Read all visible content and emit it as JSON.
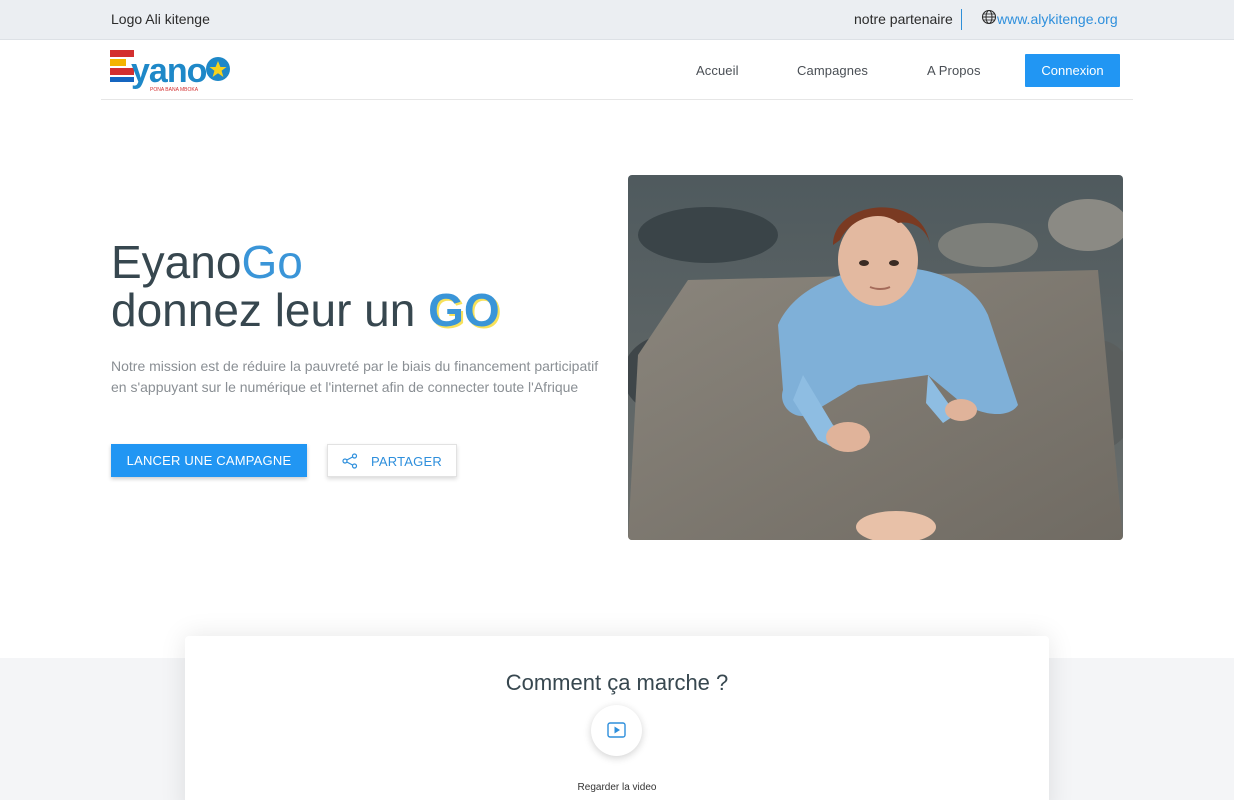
{
  "topbar": {
    "logo_text": "Logo Ali kitenge",
    "partner_text": "notre partenaire",
    "site_link": "www.alykitenge.org"
  },
  "navbar": {
    "brand_name": "Eyano",
    "brand_tagline": "PONA BANA MBOKA",
    "items": [
      {
        "label": "Accueil"
      },
      {
        "label": "Campagnes"
      },
      {
        "label": "A Propos"
      }
    ],
    "login_label": "Connexion"
  },
  "hero": {
    "title_part1": "Eyano",
    "title_part2": "Go",
    "title_line2": "donnez leur un ",
    "title_go": "GO",
    "description": "Notre mission est de réduire la pauvreté par le biais du financement participatif en s'appuyant sur le numérique et l'internet afin de connecter toute l'Afrique",
    "launch_label": "LANCER UNE CAMPAGNE",
    "share_label": "PARTAGER"
  },
  "how": {
    "title": "Comment ça marche ?",
    "watch_label": "Regarder la video"
  },
  "colors": {
    "accent": "#2196f3",
    "link": "#2e8fdc",
    "topbar_bg": "#ebeef2"
  }
}
